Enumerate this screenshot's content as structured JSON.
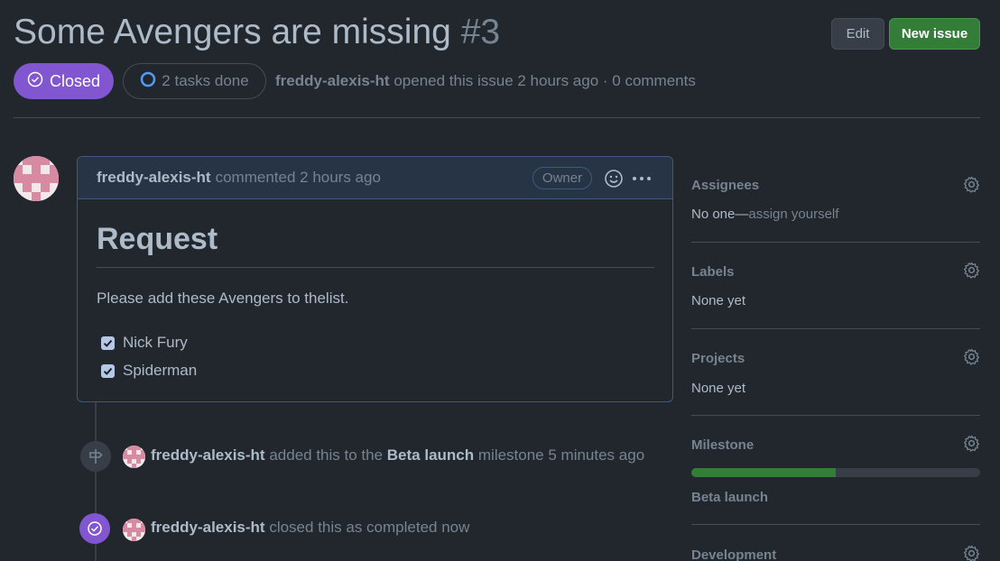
{
  "issue": {
    "title": "Some Avengers are missing",
    "number": "#3",
    "state_label": "Closed",
    "tasks_label": "2 tasks done",
    "author": "freddy-alexis-ht",
    "opened_text": "opened this issue 2 hours ago · 0 comments"
  },
  "header_buttons": {
    "edit_label": "Edit",
    "new_issue_label": "New issue"
  },
  "comment": {
    "author": "freddy-alexis-ht",
    "time_text": "commented 2 hours ago",
    "role_badge": "Owner",
    "heading": "Request",
    "paragraph": "Please add these Avengers to thelist.",
    "tasks": [
      {
        "label": "Nick Fury",
        "checked": true
      },
      {
        "label": "Spiderman",
        "checked": true
      }
    ]
  },
  "timeline": [
    {
      "icon": "milestone-icon",
      "actor": "freddy-alexis-ht",
      "text_before": "added this to the",
      "target": "Beta launch",
      "text_after": "milestone 5 minutes ago"
    },
    {
      "icon": "check-circle-icon",
      "actor": "freddy-alexis-ht",
      "text_before": "closed this as completed now"
    }
  ],
  "sidebar": {
    "assignees": {
      "heading": "Assignees",
      "value": "No one—",
      "link": "assign yourself"
    },
    "labels": {
      "heading": "Labels",
      "value": "None yet"
    },
    "projects": {
      "heading": "Projects",
      "value": "None yet"
    },
    "milestone": {
      "heading": "Milestone",
      "progress_percent": 50,
      "value": "Beta launch"
    },
    "development": {
      "heading": "Development"
    }
  },
  "colors": {
    "background": "#22272e",
    "closed_purple": "#8256d0",
    "primary_green": "#347d39",
    "comment_border": "#3c5a80"
  }
}
